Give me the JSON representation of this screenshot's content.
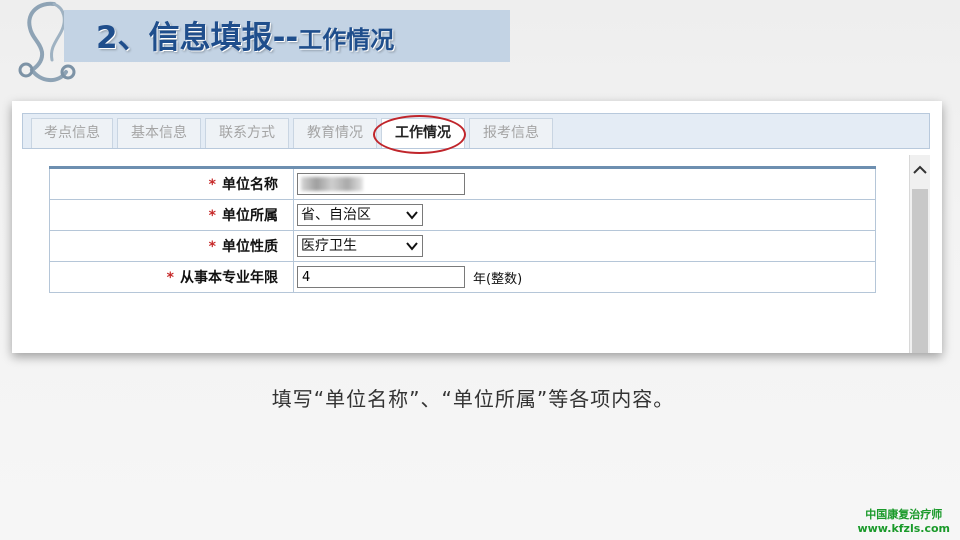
{
  "slide": {
    "title_main": "2、信息填报--",
    "title_sub": "工作情况",
    "instruction": "填写“单位名称”、“单位所属”等各项内容。",
    "watermark_line1": "中国康复治疗师",
    "watermark_line2": "www.kfzls.com"
  },
  "tabs": [
    {
      "label": "考点信息",
      "active": false
    },
    {
      "label": "基本信息",
      "active": false
    },
    {
      "label": "联系方式",
      "active": false
    },
    {
      "label": "教育情况",
      "active": false
    },
    {
      "label": "工作情况",
      "active": true
    },
    {
      "label": "报考信息",
      "active": false
    }
  ],
  "form": {
    "required_mark": "*",
    "rows": [
      {
        "label": "单位名称",
        "type": "text",
        "value": "",
        "redacted": true
      },
      {
        "label": "单位所属",
        "type": "select",
        "value": "省、自治区"
      },
      {
        "label": "单位性质",
        "type": "select",
        "value": "医疗卫生"
      },
      {
        "label": "从事本专业年限",
        "type": "text",
        "value": "4",
        "suffix": "年(整数)"
      }
    ]
  },
  "colors": {
    "title_text": "#1f4e8c",
    "title_bar": "#c3d3e4",
    "highlight_ring": "#c0252b",
    "required": "#c62828",
    "watermark": "#1a9a2a"
  },
  "icons": {
    "logo": "stethoscope-icon",
    "select_arrow": "chevron-down-icon",
    "scroll_up": "chevron-up-icon"
  }
}
